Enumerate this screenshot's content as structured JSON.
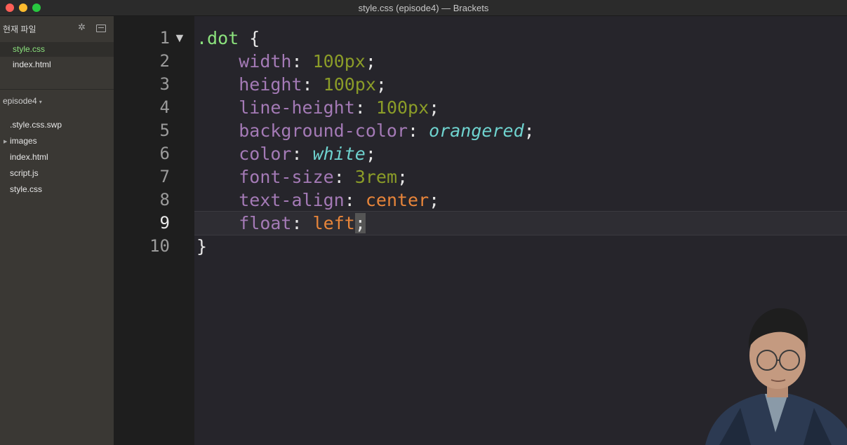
{
  "window": {
    "title": "style.css (episode4) — Brackets"
  },
  "sidebar": {
    "working_files_header": "현재 파일",
    "working_files": [
      {
        "label": "style.css",
        "selected": true
      },
      {
        "label": "index.html",
        "selected": false
      }
    ],
    "project_name": "episode4",
    "tree": [
      {
        "label": ".style.css.swp"
      },
      {
        "label": "images",
        "folder": true
      },
      {
        "label": "index.html"
      },
      {
        "label": "script.js"
      },
      {
        "label": "style.css"
      }
    ]
  },
  "editor": {
    "line_numbers": [
      "1",
      "2",
      "3",
      "4",
      "5",
      "6",
      "7",
      "8",
      "9",
      "10"
    ],
    "active_line": 9,
    "lines": [
      {
        "selector": ".dot",
        "brace": " {"
      },
      {
        "prop": "width",
        "value": "100px",
        "value_type": "num"
      },
      {
        "prop": "height",
        "value": "100px",
        "value_type": "num"
      },
      {
        "prop": "line-height",
        "value": "100px",
        "value_type": "num"
      },
      {
        "prop": "background-color",
        "value": "orangered",
        "value_type": "kw"
      },
      {
        "prop": "color",
        "value": "white",
        "value_type": "kw"
      },
      {
        "prop": "font-size",
        "value": "3rem",
        "value_type": "num"
      },
      {
        "prop": "text-align",
        "value": "center",
        "value_type": "val"
      },
      {
        "prop": "float",
        "value": "left",
        "value_type": "val"
      },
      {
        "close": "}"
      }
    ]
  }
}
